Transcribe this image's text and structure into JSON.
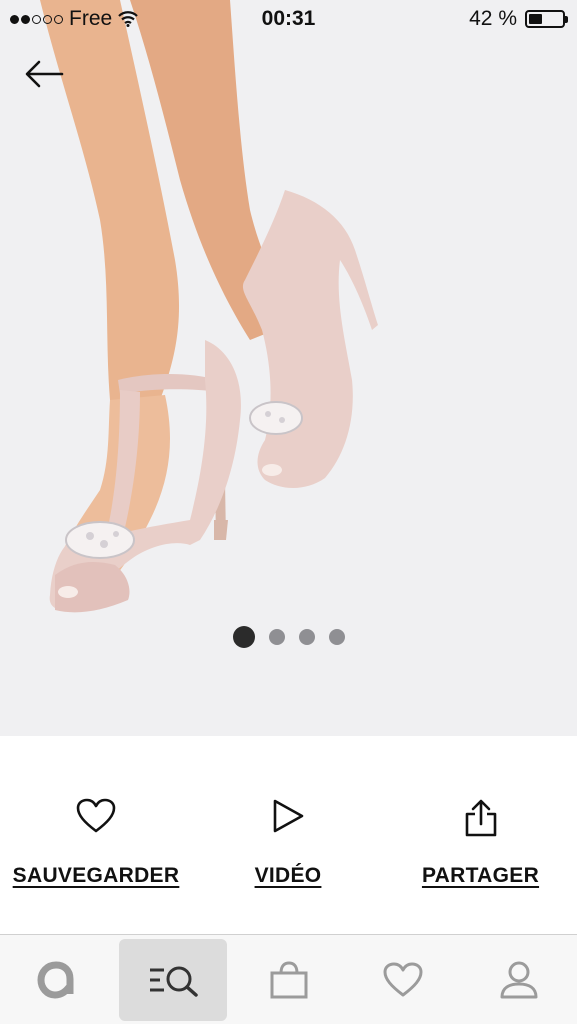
{
  "status_bar": {
    "carrier": "Free",
    "time": "00:31",
    "battery": "42 %",
    "battery_level": 0.42,
    "signal_dots_filled": 2,
    "signal_dots_total": 5
  },
  "gallery": {
    "image_count": 4,
    "active_index": 0
  },
  "actions": {
    "save_label": "SAUVEGARDER",
    "video_label": "VIDÉO",
    "share_label": "PARTAGER"
  },
  "tabbar": {
    "items": [
      {
        "icon": "asos-logo-icon",
        "active": false
      },
      {
        "icon": "search-icon",
        "active": true
      },
      {
        "icon": "bag-icon",
        "active": false
      },
      {
        "icon": "heart-icon",
        "active": false
      },
      {
        "icon": "user-icon",
        "active": false
      }
    ]
  },
  "colors": {
    "hero_bg": "#f0f0f2",
    "pager_active": "#2b2b2b",
    "pager_inactive": "#8f8f93",
    "tab_active_bg": "#dcdcdc"
  }
}
